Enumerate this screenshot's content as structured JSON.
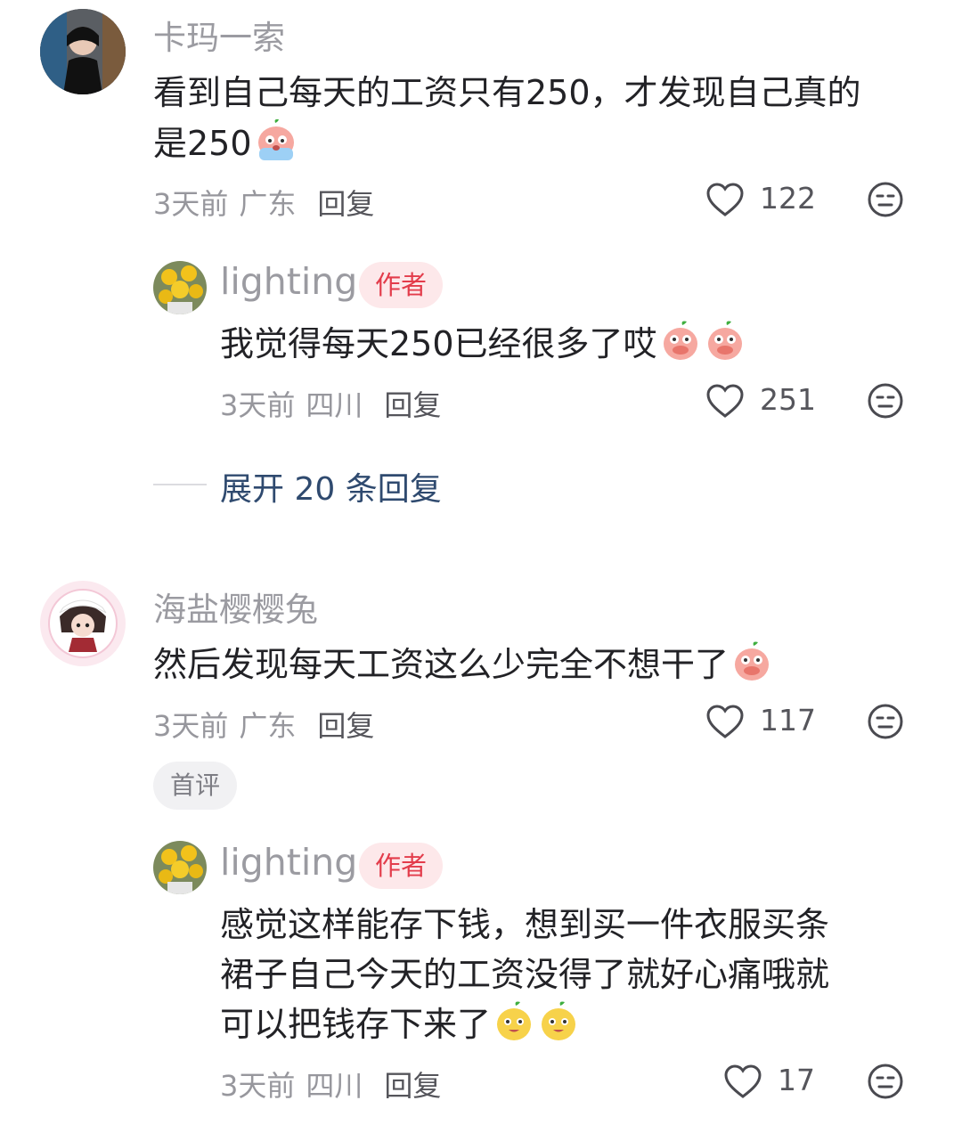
{
  "comments": [
    {
      "username": "卡玛一索",
      "text_line1": "看到自己每天的工资只有250，才发现自己真的",
      "text_line2": "是250",
      "emoji_icon": "crying-pig-emoji-icon",
      "time": "3天前",
      "location": "广东",
      "reply_label": "回复",
      "likes": "122",
      "reply": {
        "username": "lighting",
        "badge": "作者",
        "text": "我觉得每天250已经很多了哎",
        "emoji_icon": "shy-pig-emoji-icon",
        "time": "3天前",
        "location": "四川",
        "reply_label": "回复",
        "likes": "251"
      },
      "expand_label": "展开 20 条回复"
    },
    {
      "username": "海盐樱樱兔",
      "text_line1": "然后发现每天工资这么少完全不想干了",
      "emoji_icon": "shy-pig-emoji-icon",
      "time": "3天前",
      "location": "广东",
      "reply_label": "回复",
      "likes": "117",
      "first_badge": "首评",
      "reply": {
        "username": "lighting",
        "badge": "作者",
        "text_line1": "感觉这样能存下钱，想到买一件衣服买条",
        "text_line2": "裙子自己今天的工资没得了就好心痛哦就",
        "text_line3": "可以把钱存下来了",
        "emoji_icon": "smiling-chick-emoji-icon",
        "time": "3天前",
        "location": "四川",
        "reply_label": "回复",
        "likes": "17"
      }
    }
  ],
  "colors": {
    "author_tag_bg": "#fde8ea",
    "author_tag_text": "#e33c4b",
    "expand_text": "#2f4a6f"
  }
}
